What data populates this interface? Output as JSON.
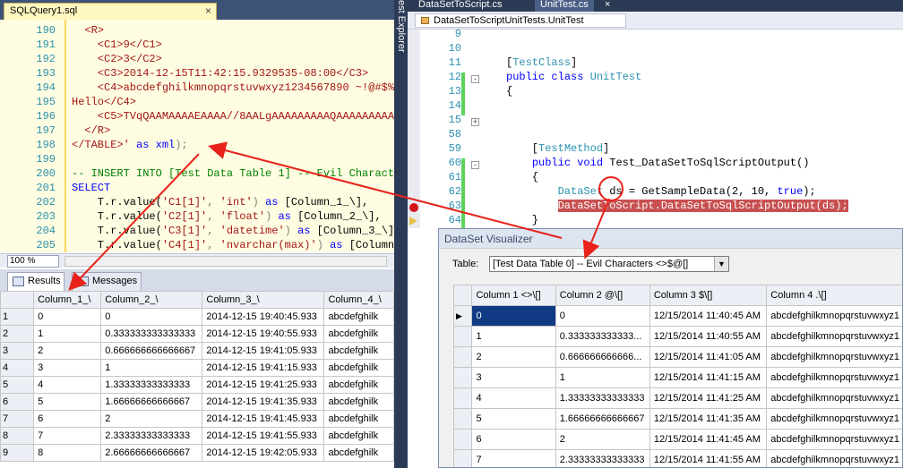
{
  "left_tab": {
    "title": "SQLQuery1.sql",
    "close": "×"
  },
  "vertical_label": "est Explorer",
  "sql_lines": [
    {
      "n": "190",
      "parts": [
        {
          "t": "  <R>",
          "c": "red"
        }
      ]
    },
    {
      "n": "191",
      "parts": [
        {
          "t": "    <C1>9</C1>",
          "c": "red"
        }
      ]
    },
    {
      "n": "192",
      "parts": [
        {
          "t": "    <C2>3</C2>",
          "c": "red"
        }
      ]
    },
    {
      "n": "193",
      "parts": [
        {
          "t": "    <C3>2014-12-15T11:42:15.9329535-08:00</C3>",
          "c": "red"
        }
      ]
    },
    {
      "n": "194",
      "parts": [
        {
          "t": "    <C4>abcdefghilkmnopqrstuvwxyz1234567890 ~!@#$%",
          "c": "red"
        }
      ]
    },
    {
      "n": "195",
      "parts": [
        {
          "t": "Hello</C4>",
          "c": "red"
        }
      ]
    },
    {
      "n": "196",
      "parts": [
        {
          "t": "    <C5>TVqQAAMAAAAEAAAA//8AALgAAAAAAAAAQAAAAAAAAAA",
          "c": "red"
        }
      ]
    },
    {
      "n": "197",
      "parts": [
        {
          "t": "  </R>",
          "c": "red"
        }
      ]
    },
    {
      "n": "198",
      "parts": [
        {
          "t": "</TABLE>'",
          "c": "red"
        },
        {
          "t": " as ",
          "c": "blu"
        },
        {
          "t": "xml",
          "c": "blu"
        },
        {
          "t": ");",
          "c": "gry"
        }
      ]
    },
    {
      "n": "199",
      "parts": [
        {
          "t": "",
          "c": "blk"
        }
      ]
    },
    {
      "n": "200",
      "parts": [
        {
          "t": "-- INSERT INTO [Test Data Table 1] -- Evil Charact",
          "c": "grn"
        }
      ]
    },
    {
      "n": "201",
      "parts": [
        {
          "t": "SELECT",
          "c": "blu"
        }
      ]
    },
    {
      "n": "202",
      "parts": [
        {
          "t": "    T.r.value(",
          "c": "blk"
        },
        {
          "t": "'C1[1]'",
          "c": "red"
        },
        {
          "t": ", ",
          "c": "gry"
        },
        {
          "t": "'int'",
          "c": "red"
        },
        {
          "t": ") ",
          "c": "gry"
        },
        {
          "t": "as",
          "c": "blu"
        },
        {
          "t": " [Column_1_\\],",
          "c": "blk"
        }
      ]
    },
    {
      "n": "203",
      "parts": [
        {
          "t": "    T.r.value(",
          "c": "blk"
        },
        {
          "t": "'C2[1]'",
          "c": "red"
        },
        {
          "t": ", ",
          "c": "gry"
        },
        {
          "t": "'float'",
          "c": "red"
        },
        {
          "t": ") ",
          "c": "gry"
        },
        {
          "t": "as",
          "c": "blu"
        },
        {
          "t": " [Column_2_\\],",
          "c": "blk"
        }
      ]
    },
    {
      "n": "204",
      "parts": [
        {
          "t": "    T.r.value(",
          "c": "blk"
        },
        {
          "t": "'C3[1]'",
          "c": "red"
        },
        {
          "t": ", ",
          "c": "gry"
        },
        {
          "t": "'datetime'",
          "c": "red"
        },
        {
          "t": ") ",
          "c": "gry"
        },
        {
          "t": "as",
          "c": "blu"
        },
        {
          "t": " [Column_3_\\]",
          "c": "blk"
        }
      ]
    },
    {
      "n": "205",
      "parts": [
        {
          "t": "    T.r.value(",
          "c": "blk"
        },
        {
          "t": "'C4[1]'",
          "c": "red"
        },
        {
          "t": ", ",
          "c": "gry"
        },
        {
          "t": "'nvarchar(max)'",
          "c": "red"
        },
        {
          "t": ") ",
          "c": "gry"
        },
        {
          "t": "as",
          "c": "blu"
        },
        {
          "t": " [Column",
          "c": "blk"
        }
      ]
    }
  ],
  "zoom": "100 %",
  "result_tabs": [
    "Results",
    "Messages"
  ],
  "left_grid": {
    "headers": [
      "",
      "Column_1_\\",
      "Column_2_\\",
      "Column_3_\\",
      "Column_4_\\"
    ],
    "rows": [
      [
        "1",
        "0",
        "0",
        "2014-12-15 19:40:45.933",
        "abcdefghilk"
      ],
      [
        "2",
        "1",
        "0.333333333333333",
        "2014-12-15 19:40:55.933",
        "abcdefghilk"
      ],
      [
        "3",
        "2",
        "0.666666666666667",
        "2014-12-15 19:41:05.933",
        "abcdefghilk"
      ],
      [
        "4",
        "3",
        "1",
        "2014-12-15 19:41:15.933",
        "abcdefghilk"
      ],
      [
        "5",
        "4",
        "1.33333333333333",
        "2014-12-15 19:41:25.933",
        "abcdefghilk"
      ],
      [
        "6",
        "5",
        "1.66666666666667",
        "2014-12-15 19:41:35.933",
        "abcdefghilk"
      ],
      [
        "7",
        "6",
        "2",
        "2014-12-15 19:41:45.933",
        "abcdefghilk"
      ],
      [
        "8",
        "7",
        "2.33333333333333",
        "2014-12-15 19:41:55.933",
        "abcdefghilk"
      ],
      [
        "9",
        "8",
        "2.66666666666667",
        "2014-12-15 19:42:05.933",
        "abcdefghilk"
      ]
    ]
  },
  "right_tabs": [
    "DataSetToScript.cs",
    "UnitTest.cs",
    "×"
  ],
  "nav_box": "DataSetToScriptUnitTests.UnitTest",
  "cs_lines": [
    {
      "n": "9",
      "parts": []
    },
    {
      "n": "10",
      "parts": []
    },
    {
      "n": "11",
      "parts": [
        {
          "t": "[",
          "c": "blk"
        },
        {
          "t": "TestClass",
          "c": "teal"
        },
        {
          "t": "]",
          "c": "blk"
        }
      ]
    },
    {
      "n": "12",
      "parts": [
        {
          "t": "public",
          "c": "blu"
        },
        {
          "t": " ",
          "c": "blk"
        },
        {
          "t": "class",
          "c": "blu"
        },
        {
          "t": " ",
          "c": "blk"
        },
        {
          "t": "UnitTest",
          "c": "teal"
        }
      ]
    },
    {
      "n": "13",
      "parts": [
        {
          "t": "{",
          "c": "blk"
        }
      ]
    },
    {
      "n": "14",
      "parts": []
    },
    {
      "n": "15",
      "parts": []
    },
    {
      "n": "58",
      "parts": []
    },
    {
      "n": "59",
      "parts": [
        {
          "t": "    [",
          "c": "blk"
        },
        {
          "t": "TestMethod",
          "c": "teal"
        },
        {
          "t": "]",
          "c": "blk"
        }
      ]
    },
    {
      "n": "60",
      "parts": [
        {
          "t": "    ",
          "c": "blk"
        },
        {
          "t": "public",
          "c": "blu"
        },
        {
          "t": " ",
          "c": "blk"
        },
        {
          "t": "void",
          "c": "blu"
        },
        {
          "t": " Test_DataSetToSqlScriptOutput()",
          "c": "blk"
        }
      ]
    },
    {
      "n": "61",
      "parts": [
        {
          "t": "    {",
          "c": "blk"
        }
      ]
    },
    {
      "n": "62",
      "parts": [
        {
          "t": "        ",
          "c": "blk"
        },
        {
          "t": "DataSet",
          "c": "teal"
        },
        {
          "t": " ds = GetSampleData(2, 10, ",
          "c": "blk"
        },
        {
          "t": "true",
          "c": "blu"
        },
        {
          "t": ");",
          "c": "blk"
        }
      ]
    },
    {
      "n": "63",
      "parts": [
        {
          "t": "        ",
          "c": "blk"
        },
        {
          "t": "DataSetToScript.DataSetToSqlScriptOutput(ds);",
          "c": "hl"
        }
      ]
    },
    {
      "n": "64",
      "parts": [
        {
          "t": "    }",
          "c": "blk"
        }
      ]
    }
  ],
  "visualizer": {
    "title": "DataSet Visualizer",
    "table_label": "Table:",
    "table_value": "[Test Data Table 0] -- Evil Characters <>$@[]",
    "headers": [
      "",
      "Column 1 <>\\[]",
      "Column 2 @\\[]",
      "Column 3 $\\[]",
      "Column 4 .\\[]"
    ],
    "rows": [
      [
        "",
        "0",
        "0",
        "12/15/2014 11:40:45 AM",
        "abcdefghilkmnopqrstuvwxyz1"
      ],
      [
        "",
        "1",
        "0.333333333333...",
        "12/15/2014 11:40:55 AM",
        "abcdefghilkmnopqrstuvwxyz1"
      ],
      [
        "",
        "2",
        "0.666666666666...",
        "12/15/2014 11:41:05 AM",
        "abcdefghilkmnopqrstuvwxyz1"
      ],
      [
        "",
        "3",
        "1",
        "12/15/2014 11:41:15 AM",
        "abcdefghilkmnopqrstuvwxyz1"
      ],
      [
        "",
        "4",
        "1.33333333333333",
        "12/15/2014 11:41:25 AM",
        "abcdefghilkmnopqrstuvwxyz1"
      ],
      [
        "",
        "5",
        "1.66666666666667",
        "12/15/2014 11:41:35 AM",
        "abcdefghilkmnopqrstuvwxyz1"
      ],
      [
        "",
        "6",
        "2",
        "12/15/2014 11:41:45 AM",
        "abcdefghilkmnopqrstuvwxyz1"
      ],
      [
        "",
        "7",
        "2.33333333333333",
        "12/15/2014 11:41:55 AM",
        "abcdefghilkmnopqrstuvwxyz1"
      ]
    ]
  },
  "colors": {
    "annotation": "#e8221b",
    "highlight": "#c85050",
    "selection": "#113a84"
  }
}
